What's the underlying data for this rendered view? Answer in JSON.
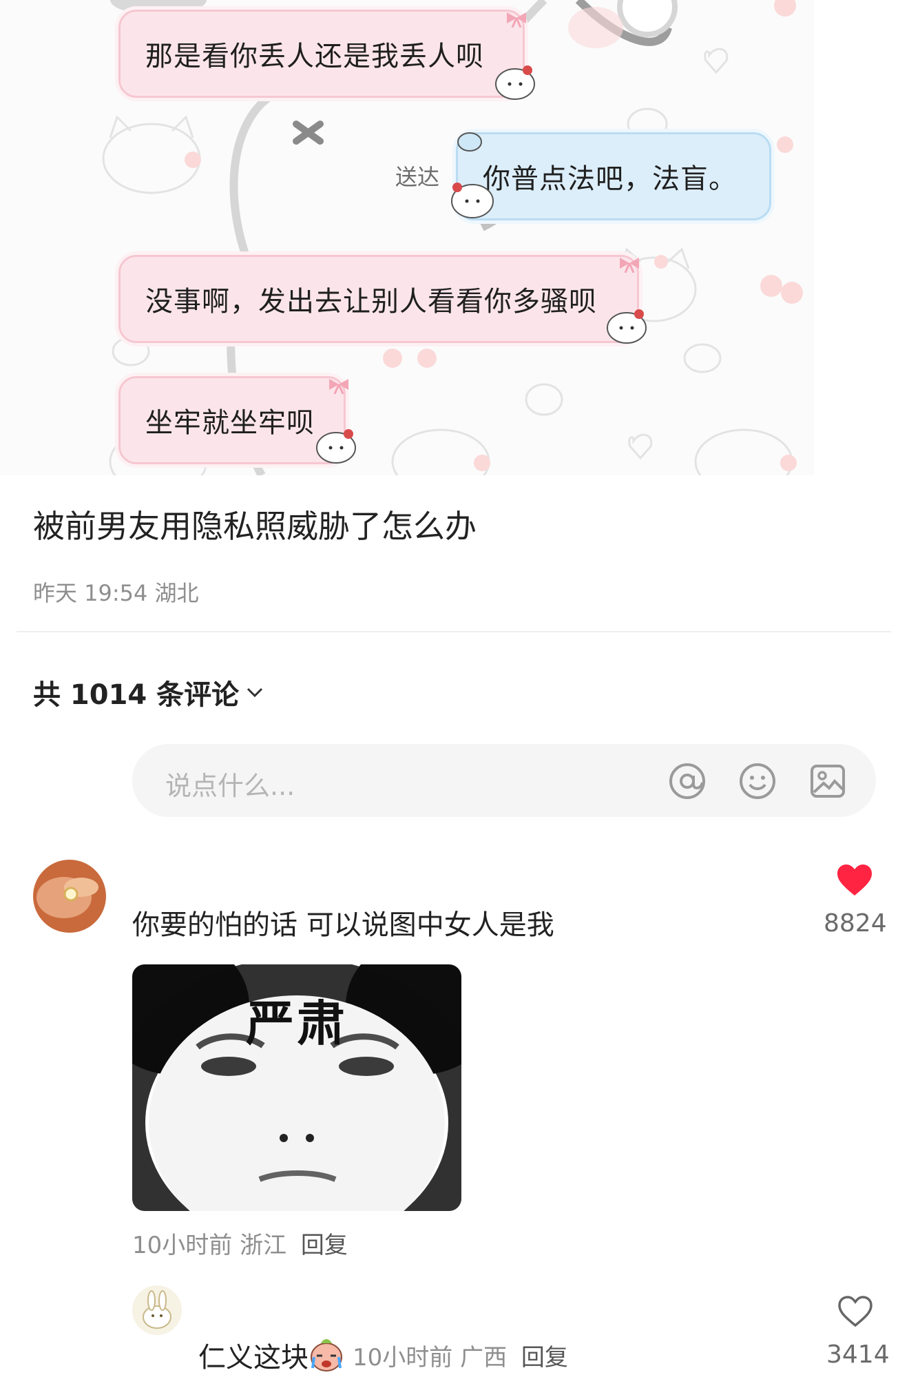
{
  "chat": {
    "messages": [
      {
        "side": "received",
        "text": "那是看你丢人还是我丢人呗"
      },
      {
        "side": "sent",
        "text": "你普点法吧，法盲。",
        "status": "送达"
      },
      {
        "side": "received",
        "text": "没事啊，发出去让别人看看你多骚呗"
      },
      {
        "side": "received",
        "text": "坐牢就坐牢呗"
      }
    ]
  },
  "post": {
    "title": "被前男友用隐私照威胁了怎么办",
    "meta": "昨天 19:54 湖北"
  },
  "comments_header": {
    "label": "共 1014 条评论",
    "icon": "chevron-down-icon"
  },
  "input": {
    "placeholder": "说点什么...",
    "icons": [
      "at-icon",
      "emoji-icon",
      "image-icon"
    ]
  },
  "comments": [
    {
      "text": "你要的怕的话 可以说图中女人是我",
      "likes": "8824",
      "liked": true,
      "sticker_caption": "严肃",
      "time": "10小时前",
      "location": "浙江",
      "reply_label": "回复",
      "reply": {
        "text": "仁义这块",
        "emoji": "crying-face-icon",
        "time": "10小时前",
        "location": "广西",
        "reply_label": "回复",
        "likes": "3414",
        "liked": false
      }
    }
  ],
  "colors": {
    "like_red": "#ff2442",
    "pink_bubble": "#fbe5ea",
    "blue_bubble": "#dceefa"
  }
}
